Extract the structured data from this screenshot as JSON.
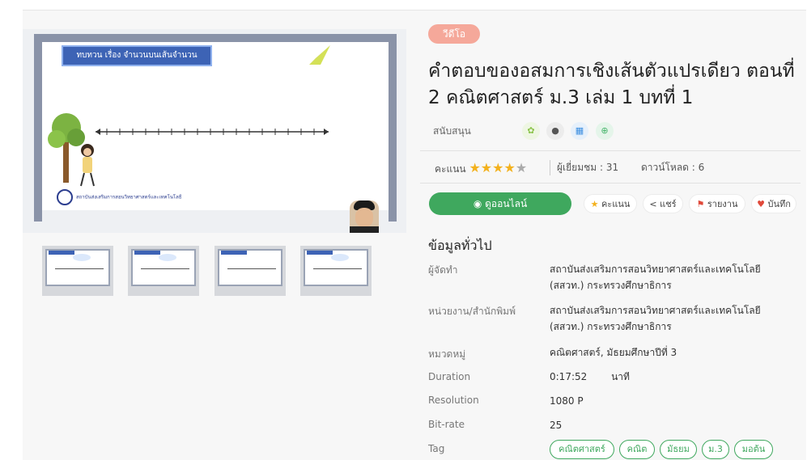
{
  "media": {
    "slide_title": "ทบทวน เรื่อง จำนวนบนเส้นจำนวน",
    "sponsor_text": "สถาบันส่งเสริมการสอนวิทยาศาสตร์และเทคโนโลยี"
  },
  "badge": "วีดีโอ",
  "title": "คำตอบของอสมการเชิงเส้นตัวแปรเดียว ตอนที่ 2 คณิตศาสตร์ ม.3 เล่ม 1 บทที่ 1",
  "support": {
    "label": "สนับสนุน",
    "platforms": [
      {
        "icon": "android-icon",
        "glyph": "✿",
        "color": "#8bc34a",
        "bg": "#eef6e3"
      },
      {
        "icon": "apple-icon",
        "glyph": "●",
        "color": "#555555",
        "bg": "#ececec"
      },
      {
        "icon": "windows-icon",
        "glyph": "▦",
        "color": "#3b8ee0",
        "bg": "#e6f0fb"
      },
      {
        "icon": "web-icon",
        "glyph": "⊕",
        "color": "#46b46b",
        "bg": "#e5f5ea"
      }
    ]
  },
  "stats": {
    "rating_label": "คะแนน",
    "rating": 4,
    "rating_max": 5,
    "views": "ผู้เยี่ยมชม : 31",
    "downloads": "ดาวน์โหลด : 6"
  },
  "actions": {
    "watch": "ดูออนไลน์",
    "rate": "คะแนน",
    "share": "แชร์",
    "report": "รายงาน",
    "save": "บันทึก"
  },
  "info": {
    "title": "ข้อมูลทั่วไป",
    "rows": [
      {
        "label": "ผู้จัดทำ",
        "value": "สถาบันส่งเสริมการสอนวิทยาศาสตร์และเทคโนโลยี (สสวท.) กระทรวงศึกษาธิการ"
      },
      {
        "label": "หน่วยงาน/สำนักพิมพ์",
        "value": "สถาบันส่งเสริมการสอนวิทยาศาสตร์และเทคโนโลยี (สสวท.) กระทรวงศึกษาธิการ"
      },
      {
        "label": "หมวดหมู่",
        "value": "คณิตศาสตร์, มัธยมศึกษาปีที่ 3"
      },
      {
        "label": "Duration",
        "value": "0:17:52",
        "unit": "นาที"
      },
      {
        "label": "Resolution",
        "value": "1080 P"
      },
      {
        "label": "Bit-rate",
        "value": "25"
      },
      {
        "label": "Tag",
        "value": ""
      }
    ],
    "tags": [
      "คณิตศาสตร์",
      "คณิต",
      "มัธยม",
      "ม.3",
      "มอต้น"
    ]
  },
  "colors": {
    "accent": "#3fa85e",
    "badge": "#f5a89a",
    "star": "#f3b11d",
    "report": "#e0493a",
    "save": "#e0493a"
  }
}
